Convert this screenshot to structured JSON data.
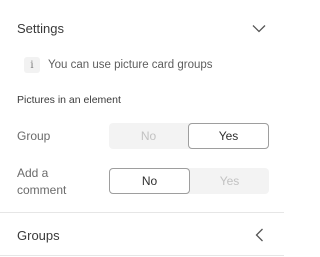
{
  "settings": {
    "title": "Settings",
    "chevron_icon": "chevron-down-icon",
    "info": {
      "icon_text": "i",
      "text": "You can use picture card groups"
    },
    "pictures_section_title": "Pictures in an element",
    "group": {
      "label": "Group",
      "options": [
        "No",
        "Yes"
      ],
      "selected": "Yes"
    },
    "comment": {
      "label_line1": "Add a",
      "label_line2": "comment",
      "options": [
        "No",
        "Yes"
      ],
      "selected": "No"
    }
  },
  "groups": {
    "title": "Groups",
    "chevron_icon": "chevron-left-icon"
  },
  "colors": {
    "border": "#e6e6e6",
    "toggle_bg": "#f3f3f3",
    "active_border": "#9e9e9e"
  }
}
